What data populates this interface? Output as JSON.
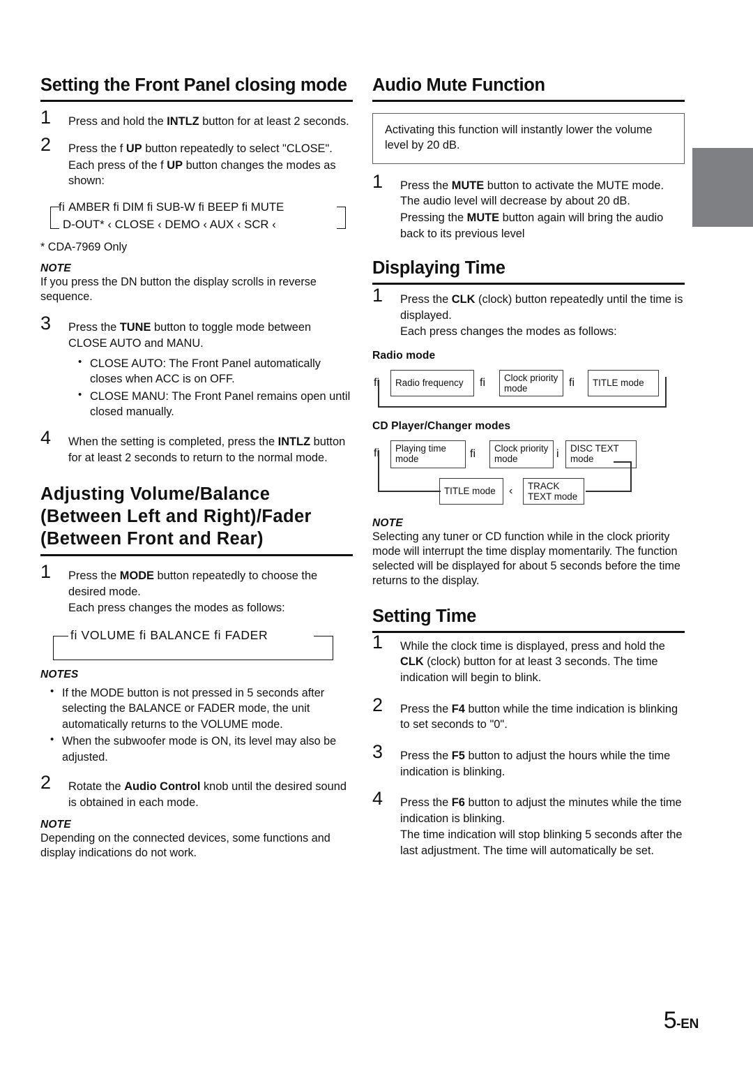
{
  "page": {
    "number": "5",
    "lang_suffix": "-EN"
  },
  "left_column": {
    "section1": {
      "heading": "Setting the Front Panel closing mode",
      "steps": [
        {
          "num": "1",
          "lines": [
            {
              "parts": [
                {
                  "t": "Press and hold the "
                },
                {
                  "t": "INTLZ",
                  "b": true
                },
                {
                  "t": " button for at least 2 seconds."
                }
              ]
            }
          ]
        },
        {
          "num": "2",
          "lines": [
            {
              "parts": [
                {
                  "t": "Press the f"
                },
                {
                  "t": "        "
                },
                {
                  "t": "UP",
                  "b": true
                },
                {
                  "t": " button repeatedly to select \"CLOSE\"."
                }
              ]
            },
            {
              "parts": [
                {
                  "t": "Each press of the f"
                },
                {
                  "t": "        "
                },
                {
                  "t": "UP",
                  "b": true
                },
                {
                  "t": " button changes the modes as shown:"
                }
              ]
            }
          ]
        }
      ],
      "flow_amber": {
        "top_row": "AMBER fi  DIM fi  SUB-W fi  BEEP fi  MUTE",
        "bottom_row": "D-OUT* ‹   CLOSE ‹   DEMO ‹   AUX ‹   SCR ‹",
        "lead_glyph": "fi"
      },
      "footnote": "* CDA-7969 Only",
      "note1": {
        "title": "NOTE",
        "body": "If you press the DN        button the display scrolls in reverse sequence."
      },
      "steps_cont": [
        {
          "num": "3",
          "lines": [
            {
              "parts": [
                {
                  "t": "Press the "
                },
                {
                  "t": "TUNE",
                  "b": true
                },
                {
                  "t": " button to toggle mode between CLOSE AUTO and MANU."
                }
              ]
            }
          ],
          "bullets": [
            "CLOSE AUTO: The Front Panel automatically closes when ACC is on OFF.",
            "CLOSE MANU: The Front Panel remains open until closed manually."
          ]
        },
        {
          "num": "4",
          "lines": [
            {
              "parts": [
                {
                  "t": "When the setting is completed, press the "
                },
                {
                  "t": "INTLZ",
                  "b": true
                },
                {
                  "t": " button for at least 2 seconds to return to the normal mode."
                }
              ]
            }
          ]
        }
      ]
    },
    "section2": {
      "heading_lines": [
        "Adjusting  Volume/Balance",
        "(Between  Left  and  Right)/Fader",
        "(Between  Front  and  Rear)"
      ],
      "step1": {
        "num": "1",
        "lines": [
          {
            "parts": [
              {
                "t": "Press the "
              },
              {
                "t": "MODE",
                "b": true
              },
              {
                "t": " button repeatedly to choose the desired mode."
              }
            ]
          },
          {
            "parts": [
              {
                "t": "Each press changes the modes as follows:"
              }
            ]
          }
        ]
      },
      "flow_volume": "fi  VOLUME  fi  BALANCE  fi  FADER",
      "notes": {
        "title": "NOTES",
        "items": [
          "If the MODE button is not pressed in 5 seconds after selecting the BALANCE or FADER mode, the unit automatically returns to the VOLUME mode.",
          "When the subwoofer mode is ON, its level may also be adjusted."
        ]
      },
      "step2": {
        "num": "2",
        "lines": [
          {
            "parts": [
              {
                "t": "Rotate the "
              },
              {
                "t": "Audio Control",
                "b": true
              },
              {
                "t": " knob until the desired sound is obtained in each mode."
              }
            ]
          }
        ]
      },
      "note_end": {
        "title": "NOTE",
        "body": "Depending on the connected devices, some functions and display indications do not work."
      }
    }
  },
  "right_column": {
    "section_mute": {
      "heading": "Audio Mute Function",
      "boxed_text": "Activating this function will instantly lower the volume level by 20 dB.",
      "step1": {
        "num": "1",
        "lines": [
          {
            "parts": [
              {
                "t": "Press the "
              },
              {
                "t": "MUTE",
                "b": true
              },
              {
                "t": " button to activate the MUTE mode. The audio level will decrease by about 20 dB."
              }
            ]
          },
          {
            "parts": [
              {
                "t": "Pressing the "
              },
              {
                "t": "MUTE",
                "b": true
              },
              {
                "t": " button again will bring the audio back to its previous level"
              }
            ]
          }
        ]
      }
    },
    "section_display": {
      "heading": "Displaying Time",
      "step1": {
        "num": "1",
        "lines": [
          {
            "parts": [
              {
                "t": "Press the "
              },
              {
                "t": "CLK",
                "b": true
              },
              {
                "t": " (clock) button repeatedly until the time is displayed."
              }
            ]
          },
          {
            "parts": [
              {
                "t": "Each press changes the modes as follows:"
              }
            ]
          }
        ]
      },
      "radio": {
        "subhead": "Radio mode",
        "lead_glyph": "fi",
        "boxes": [
          "Radio frequency",
          "Clock priority mode",
          "TITLE mode"
        ],
        "arrows": [
          "fi",
          "fi"
        ]
      },
      "cd": {
        "subhead": "CD Player/Changer modes",
        "lead_glyph": "fi",
        "boxes_top": [
          "Playing time mode",
          "Clock priority mode",
          "DISC TEXT mode"
        ],
        "boxes_bottom": [
          "TITLE mode",
          "TRACK TEXT mode"
        ],
        "arrows_top": [
          "fi",
          "i"
        ],
        "arrow_bottom": "‹"
      },
      "note": {
        "title": "NOTE",
        "body": "Selecting any tuner or CD function while in the clock priority mode will interrupt the time display momentarily. The function selected will be displayed for about 5 seconds before the time returns to the display."
      }
    },
    "section_setting": {
      "heading": "Setting Time",
      "steps": [
        {
          "num": "1",
          "lines": [
            {
              "parts": [
                {
                  "t": "While the clock time is displayed, press and hold the "
                },
                {
                  "t": "CLK",
                  "b": true
                },
                {
                  "t": " (clock) button for at least 3 seconds. The time indication will begin to blink."
                }
              ]
            }
          ]
        },
        {
          "num": "2",
          "lines": [
            {
              "parts": [
                {
                  "t": "Press the "
                },
                {
                  "t": "F4",
                  "b": true
                },
                {
                  "t": " button while the time indication is blinking to set seconds to \"0\"."
                }
              ]
            }
          ]
        },
        {
          "num": "3",
          "lines": [
            {
              "parts": [
                {
                  "t": "Press the "
                },
                {
                  "t": "F5",
                  "b": true
                },
                {
                  "t": " button to adjust the hours while the time indication is blinking."
                }
              ]
            }
          ]
        },
        {
          "num": "4",
          "lines": [
            {
              "parts": [
                {
                  "t": "Press the "
                },
                {
                  "t": "F6",
                  "b": true
                },
                {
                  "t": " button to adjust the minutes while the time indication is blinking."
                }
              ]
            },
            {
              "parts": [
                {
                  "t": "The time indication will stop blinking 5 seconds after the last adjustment. The time will automatically be set."
                }
              ]
            }
          ]
        }
      ]
    }
  },
  "colors": {
    "gray_tab": "#7e8084",
    "rule": "#111111",
    "box_border": "#3a3a3a"
  }
}
